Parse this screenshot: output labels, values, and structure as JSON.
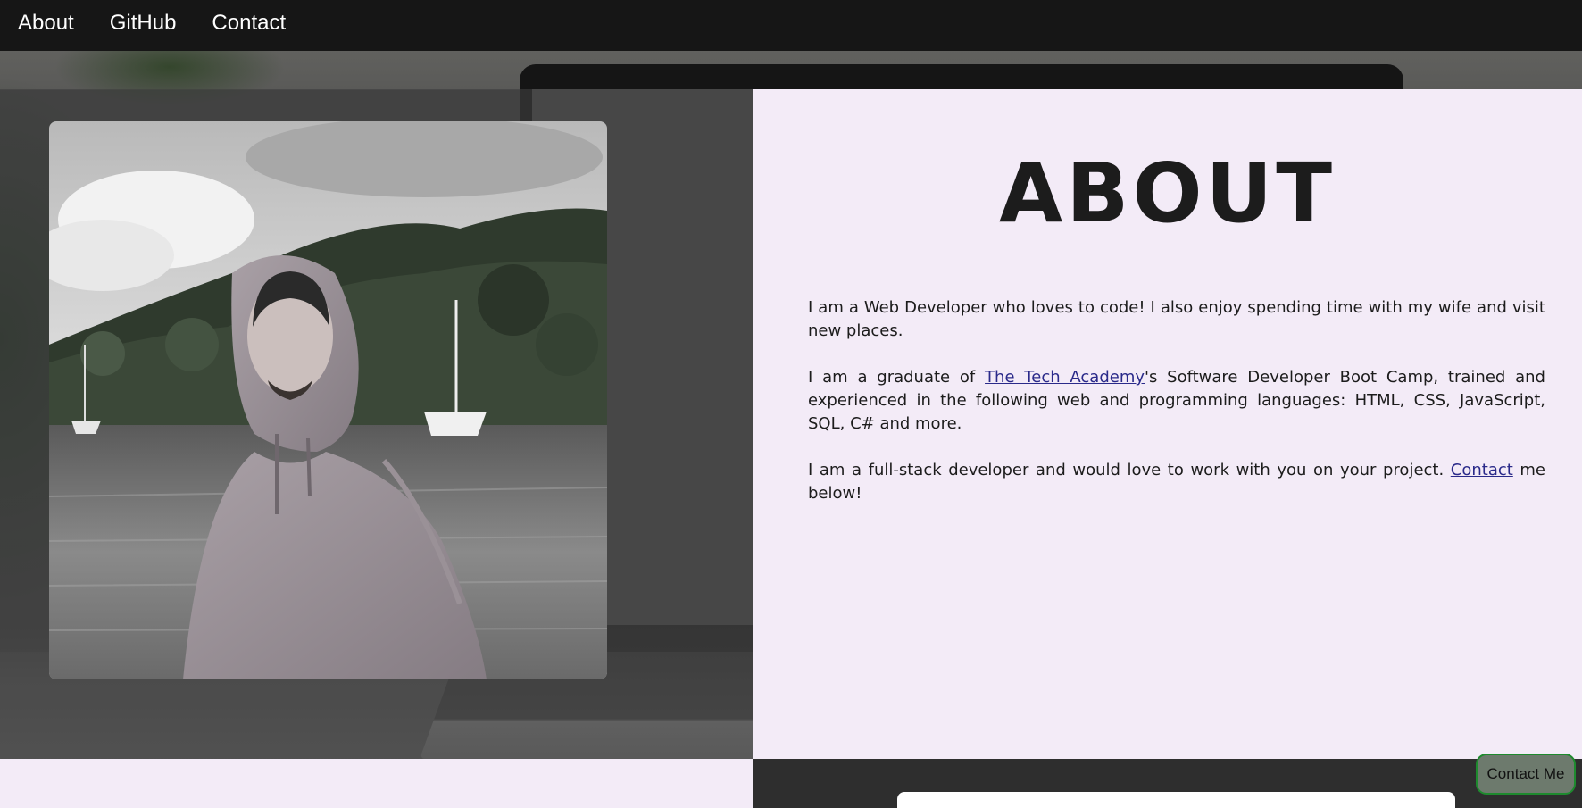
{
  "nav": {
    "items": [
      {
        "label": "About"
      },
      {
        "label": "GitHub"
      },
      {
        "label": "Contact"
      }
    ]
  },
  "about": {
    "title": "ABOUT",
    "p1": "I am a Web Developer who loves to code! I also enjoy spending time with my wife and visit new places.",
    "p2_before": "I am a graduate of ",
    "p2_link": "The Tech Academy",
    "p2_after": "'s Software Developer Boot Camp, trained and experienced in the following web and programming languages: HTML, CSS, JavaScript, SQL, C# and more.",
    "p3_before": "I am a full-stack developer and would love to work with you on your project. ",
    "p3_link": "Contact",
    "p3_after": " me below!"
  },
  "contact_button": {
    "label": "Contact Me"
  },
  "colors": {
    "nav_bg": "#161616",
    "panel_bg": "#f3ebf7",
    "text": "#1c1c1c",
    "link": "#2a2a8a",
    "contact_border": "#1e8a2e"
  }
}
